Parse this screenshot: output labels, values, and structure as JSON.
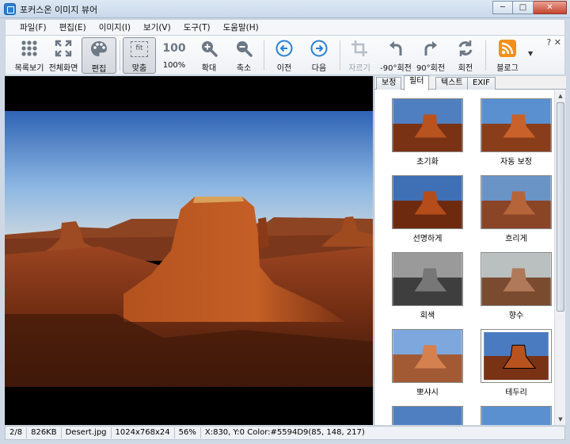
{
  "window": {
    "title": "포커스온 이미지 뷰어",
    "minimize": "─",
    "maximize": "□",
    "close": "✕"
  },
  "menu": [
    "파일(F)",
    "편집(E)",
    "이미지(I)",
    "보기(V)",
    "도구(T)",
    "도움말(H)"
  ],
  "toolbar": {
    "list": "목록보기",
    "fullscreen": "전체화면",
    "edit": "편집",
    "fit": "맞춤",
    "fit_glyph": "fit",
    "actual": "100%",
    "actual_glyph": "100",
    "zoom_in": "확대",
    "zoom_out": "축소",
    "prev": "이전",
    "next": "다음",
    "crop": "자르기",
    "rotate_left": "-90°회전",
    "rotate_right": "90°회전",
    "rotate": "회전",
    "blog": "블로그",
    "help_close": "? ✕"
  },
  "panel": {
    "tabs": [
      "보정",
      "필터",
      "텍스트",
      "EXIF"
    ],
    "active_tab": "필터",
    "filters": [
      "초기화",
      "자동 보정",
      "선명하게",
      "흐리게",
      "회색",
      "향수",
      "뽀샤시",
      "테두리",
      "",
      ""
    ]
  },
  "status": {
    "index": "2/8",
    "size": "826KB",
    "filename": "Desert.jpg",
    "dimensions": "1024x768x24",
    "zoom": "56%",
    "cursor": "X:830, Y:0 Color:#5594D9(85, 148, 217)"
  },
  "colors": {
    "accent": "#2a7fd3",
    "sky_top": "#2f63b4",
    "rock": "#a8431c"
  },
  "icons": [
    "grid-icon",
    "fullscreen-icon",
    "palette-icon",
    "fit-icon",
    "zoom-in-icon",
    "zoom-out-icon",
    "prev-arrow-icon",
    "next-arrow-icon",
    "crop-icon",
    "rotate-left-icon",
    "rotate-right-icon",
    "rotate-icon",
    "rss-icon"
  ]
}
